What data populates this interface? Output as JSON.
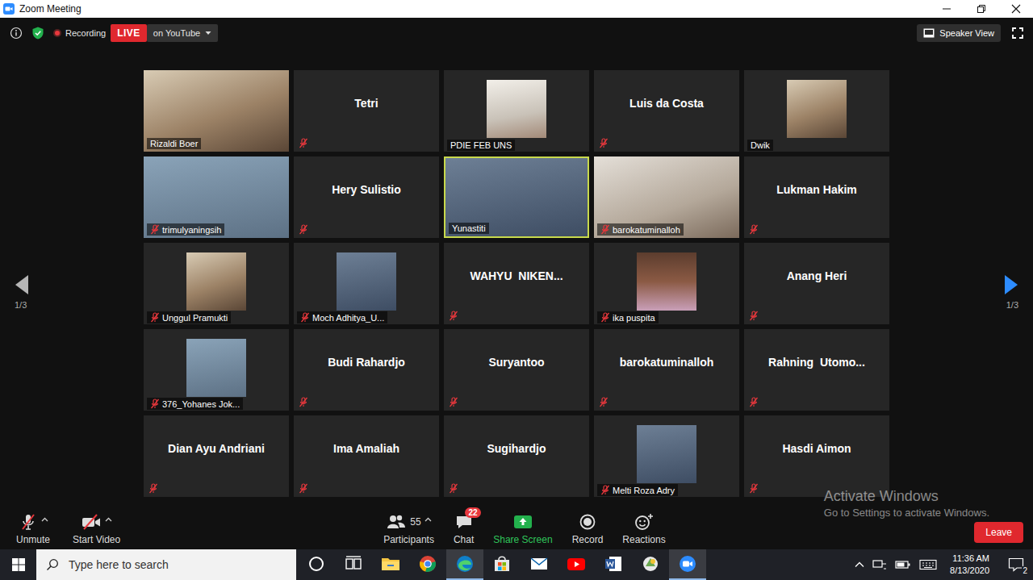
{
  "window": {
    "title": "Zoom Meeting"
  },
  "top_bar": {
    "recording": "Recording",
    "live": "LIVE",
    "stream": "on YouTube",
    "view": "Speaker View"
  },
  "pager": {
    "previous": "1/3",
    "next": "1/3",
    "previous_active": false,
    "next_active": true
  },
  "tiles": [
    {
      "name": "Rizaldi Boer",
      "kind": "video",
      "muted": false,
      "speaking": false
    },
    {
      "name": "Tetri",
      "kind": "name",
      "muted": true,
      "speaking": false
    },
    {
      "name": "PDIE FEB UNS",
      "kind": "picture",
      "muted": false,
      "speaking": false
    },
    {
      "name": "Luis da Costa",
      "kind": "name",
      "muted": true,
      "speaking": false
    },
    {
      "name": "Dwik",
      "kind": "picture",
      "muted": false,
      "speaking": false
    },
    {
      "name": "trimulyaningsih",
      "kind": "video",
      "muted": true,
      "speaking": false
    },
    {
      "name": "Hery Sulistio",
      "kind": "name",
      "muted": true,
      "speaking": false
    },
    {
      "name": "Yunastiti",
      "kind": "video",
      "muted": false,
      "speaking": true
    },
    {
      "name": "barokatuminalloh",
      "kind": "video",
      "muted": true,
      "speaking": false
    },
    {
      "name": "Lukman Hakim",
      "kind": "name",
      "muted": true,
      "speaking": false
    },
    {
      "name": "Unggul Pramukti",
      "kind": "picture",
      "muted": true,
      "speaking": false
    },
    {
      "name": "Moch Adhitya_U...",
      "kind": "picture",
      "muted": true,
      "speaking": false
    },
    {
      "name": "WAHYU  NIKEN...",
      "kind": "name",
      "muted": true,
      "speaking": false
    },
    {
      "name": "ika puspita",
      "kind": "picture",
      "muted": true,
      "speaking": false
    },
    {
      "name": "Anang Heri",
      "kind": "name",
      "muted": true,
      "speaking": false
    },
    {
      "name": "376_Yohanes Jok...",
      "kind": "picture",
      "muted": true,
      "speaking": false
    },
    {
      "name": "Budi Rahardjo",
      "kind": "name",
      "muted": true,
      "speaking": false
    },
    {
      "name": "Suryantoo",
      "kind": "name",
      "muted": true,
      "speaking": false
    },
    {
      "name": "barokatuminalloh",
      "kind": "name",
      "muted": true,
      "speaking": false
    },
    {
      "name": "Rahning  Utomo...",
      "kind": "name",
      "muted": true,
      "speaking": false
    },
    {
      "name": "Dian Ayu Andriani",
      "kind": "name",
      "muted": true,
      "speaking": false
    },
    {
      "name": "Ima Amaliah",
      "kind": "name",
      "muted": true,
      "speaking": false
    },
    {
      "name": "Sugihardjo",
      "kind": "name",
      "muted": true,
      "speaking": false
    },
    {
      "name": "Melti Roza Adry",
      "kind": "picture",
      "muted": true,
      "speaking": false
    },
    {
      "name": "Hasdi Aimon",
      "kind": "name",
      "muted": true,
      "speaking": false
    }
  ],
  "toolbar": {
    "left": [
      {
        "label": "Unmute",
        "kind": "mic",
        "caret": true,
        "count": "",
        "badge": "",
        "highlight": false
      },
      {
        "label": "Start Video",
        "kind": "video",
        "caret": true,
        "count": "",
        "badge": "",
        "highlight": false
      }
    ],
    "center": [
      {
        "label": "Participants",
        "kind": "participants",
        "caret": true,
        "count": "55",
        "badge": "",
        "highlight": false
      },
      {
        "label": "Chat",
        "kind": "chat",
        "caret": false,
        "count": "",
        "badge": "22",
        "highlight": false
      },
      {
        "label": "Share Screen",
        "kind": "share",
        "caret": false,
        "count": "",
        "badge": "",
        "highlight": true
      },
      {
        "label": "Record",
        "kind": "record",
        "caret": false,
        "count": "",
        "badge": "",
        "highlight": false
      },
      {
        "label": "Reactions",
        "kind": "reactions",
        "caret": false,
        "count": "",
        "badge": "",
        "highlight": false
      }
    ],
    "leave": "Leave"
  },
  "watermark": {
    "title": "Activate Windows",
    "subtitle": "Go to Settings to activate Windows."
  },
  "taskbar": {
    "search": {
      "placeholder": "Type here to search"
    },
    "apps": [
      {
        "kind": "cortana",
        "active": false
      },
      {
        "kind": "taskview",
        "active": false
      },
      {
        "kind": "explorer",
        "active": false
      },
      {
        "kind": "chrome",
        "active": false
      },
      {
        "kind": "edge",
        "active": true
      },
      {
        "kind": "store",
        "active": false
      },
      {
        "kind": "mail",
        "active": false
      },
      {
        "kind": "youtube",
        "active": false
      },
      {
        "kind": "word",
        "active": false
      },
      {
        "kind": "app",
        "active": false
      },
      {
        "kind": "zoom",
        "active": true
      }
    ],
    "clock": {
      "time": "11:36 AM",
      "date": "8/13/2020"
    },
    "notifications": "2"
  }
}
